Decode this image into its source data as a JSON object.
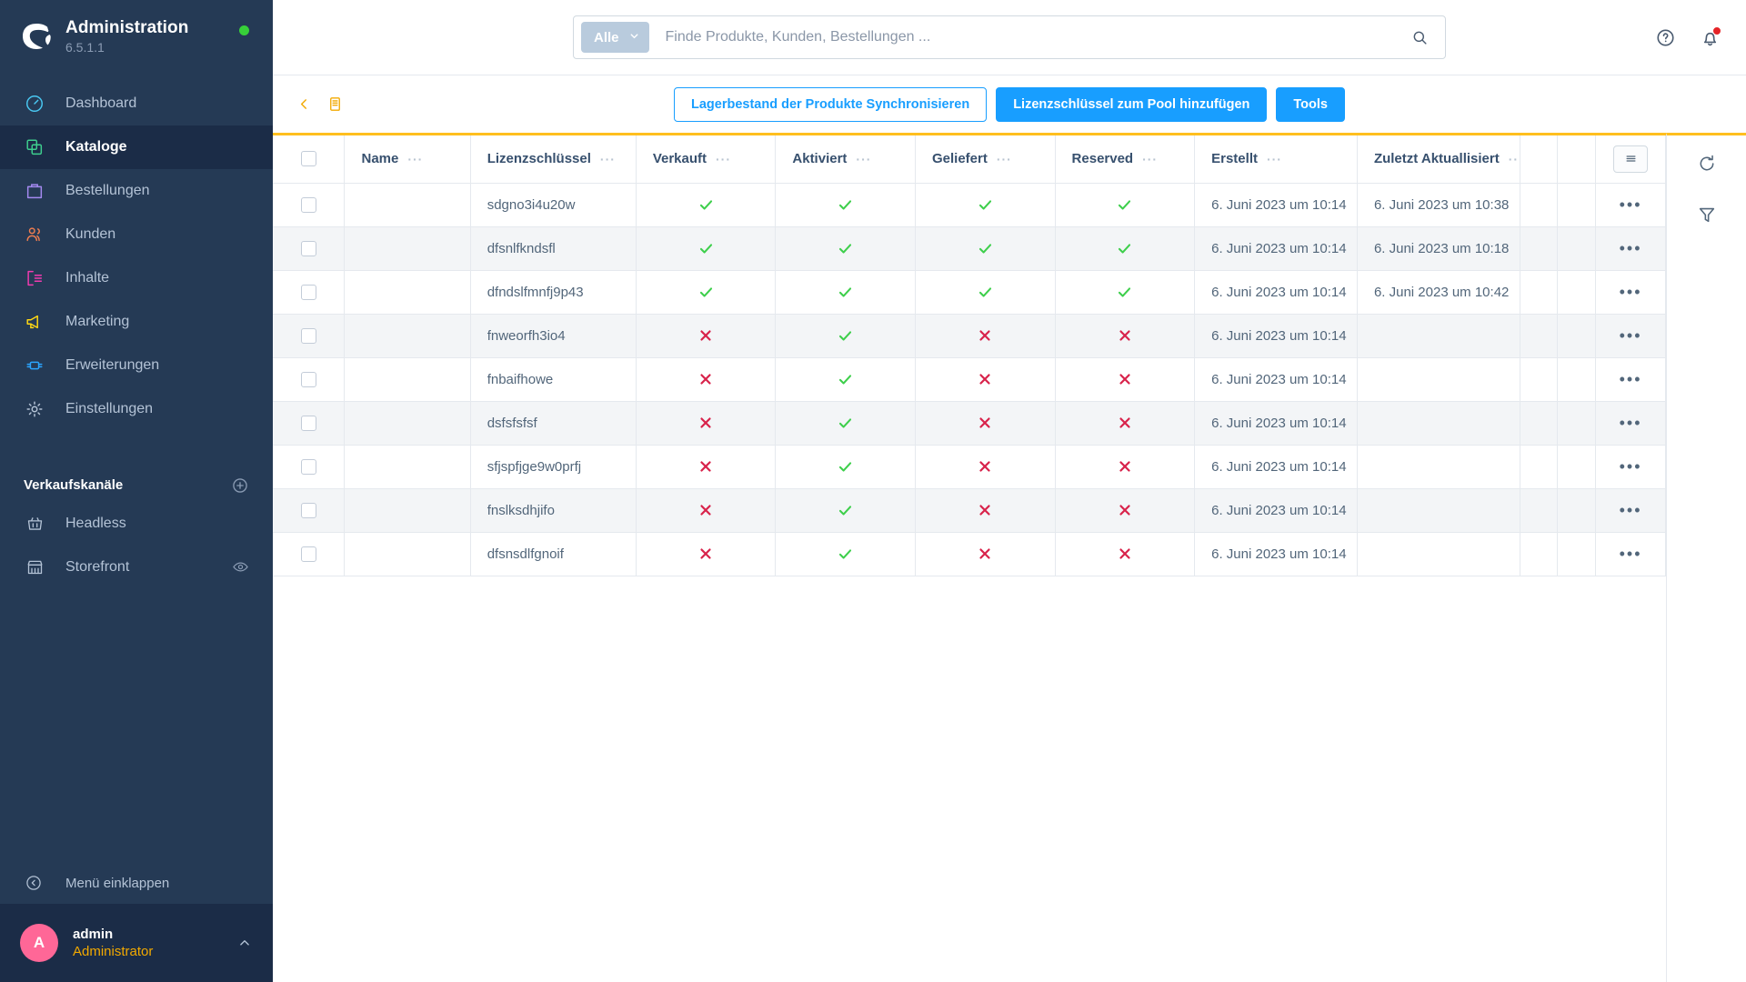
{
  "sidebar": {
    "brand": {
      "title": "Administration",
      "version": "6.5.1.1",
      "status_color": "#37d039"
    },
    "items": [
      {
        "label": "Dashboard",
        "icon": "dashboard-icon",
        "color": "#49c8f2",
        "active": false
      },
      {
        "label": "Kataloge",
        "icon": "catalog-icon",
        "color": "#3ecf8e",
        "active": true
      },
      {
        "label": "Bestellungen",
        "icon": "orders-icon",
        "color": "#a489f0",
        "active": false
      },
      {
        "label": "Kunden",
        "icon": "customers-icon",
        "color": "#ef7d50",
        "active": false
      },
      {
        "label": "Inhalte",
        "icon": "content-icon",
        "color": "#f23bb0",
        "active": false
      },
      {
        "label": "Marketing",
        "icon": "marketing-icon",
        "color": "#ffd814",
        "active": false
      },
      {
        "label": "Erweiterungen",
        "icon": "extensions-icon",
        "color": "#2ba5ff",
        "active": false
      },
      {
        "label": "Einstellungen",
        "icon": "settings-icon",
        "color": "#b4c3d6",
        "active": false
      }
    ],
    "sales_channels": {
      "title": "Verkaufskanäle",
      "items": [
        {
          "label": "Headless",
          "icon": "basket-icon"
        },
        {
          "label": "Storefront",
          "icon": "storefront-icon"
        }
      ]
    },
    "collapse_label": "Menü einklappen",
    "user": {
      "initial": "A",
      "name": "admin",
      "role": "Administrator",
      "avatar_color": "#ff6797"
    }
  },
  "topbar": {
    "search": {
      "scope": "Alle",
      "value": "",
      "placeholder": "Finde Produkte, Kunden, Bestellungen ..."
    },
    "icons": [
      {
        "name": "help-icon"
      },
      {
        "name": "notification-bell-icon",
        "badge": true
      }
    ]
  },
  "toolbar": {
    "back_label": "",
    "buttons": [
      {
        "label": "Lagerbestand der Produkte Synchronisieren",
        "style": "ghost"
      },
      {
        "label": "Lizenzschlüssel zum Pool hinzufügen",
        "style": "primary"
      },
      {
        "label": "Tools",
        "style": "primary"
      }
    ],
    "accent_color": "#189eff",
    "crumb_color": "#f2a900"
  },
  "grid": {
    "top_border_color": "#ffbf1e",
    "columns": [
      {
        "key": "name",
        "label": "Name"
      },
      {
        "key": "license",
        "label": "Lizenzschlüssel"
      },
      {
        "key": "sold",
        "label": "Verkauft"
      },
      {
        "key": "activated",
        "label": "Aktiviert"
      },
      {
        "key": "delivered",
        "label": "Geliefert"
      },
      {
        "key": "reserved",
        "label": "Reserved"
      },
      {
        "key": "created",
        "label": "Erstellt"
      },
      {
        "key": "updated",
        "label": "Zuletzt Aktuallisiert"
      }
    ],
    "check_color_true": "#3ecf4c",
    "check_color_false": "#d8234b",
    "rows": [
      {
        "name": "",
        "license": "sdgno3i4u20w",
        "sold": true,
        "activated": true,
        "delivered": true,
        "reserved": true,
        "created": "6. Juni 2023 um 10:14",
        "updated": "6. Juni 2023 um 10:38"
      },
      {
        "name": "",
        "license": "dfsnlfkndsfl",
        "sold": true,
        "activated": true,
        "delivered": true,
        "reserved": true,
        "created": "6. Juni 2023 um 10:14",
        "updated": "6. Juni 2023 um 10:18"
      },
      {
        "name": "",
        "license": "dfndslfmnfj9p43",
        "sold": true,
        "activated": true,
        "delivered": true,
        "reserved": true,
        "created": "6. Juni 2023 um 10:14",
        "updated": "6. Juni 2023 um 10:42"
      },
      {
        "name": "",
        "license": "fnweorfh3io4",
        "sold": false,
        "activated": true,
        "delivered": false,
        "reserved": false,
        "created": "6. Juni 2023 um 10:14",
        "updated": ""
      },
      {
        "name": "",
        "license": "fnbaifhowe",
        "sold": false,
        "activated": true,
        "delivered": false,
        "reserved": false,
        "created": "6. Juni 2023 um 10:14",
        "updated": ""
      },
      {
        "name": "",
        "license": "dsfsfsfsf",
        "sold": false,
        "activated": true,
        "delivered": false,
        "reserved": false,
        "created": "6. Juni 2023 um 10:14",
        "updated": ""
      },
      {
        "name": "",
        "license": "sfjspfjge9w0prfj",
        "sold": false,
        "activated": true,
        "delivered": false,
        "reserved": false,
        "created": "6. Juni 2023 um 10:14",
        "updated": ""
      },
      {
        "name": "",
        "license": "fnslksdhjifo",
        "sold": false,
        "activated": true,
        "delivered": false,
        "reserved": false,
        "created": "6. Juni 2023 um 10:14",
        "updated": ""
      },
      {
        "name": "",
        "license": "dfsnsdlfgnoif",
        "sold": false,
        "activated": true,
        "delivered": false,
        "reserved": false,
        "created": "6. Juni 2023 um 10:14",
        "updated": ""
      }
    ],
    "row_menu_glyph": "•••",
    "column_dots_glyph": "···"
  },
  "side_tools": [
    {
      "name": "refresh-icon"
    },
    {
      "name": "filter-icon"
    }
  ]
}
